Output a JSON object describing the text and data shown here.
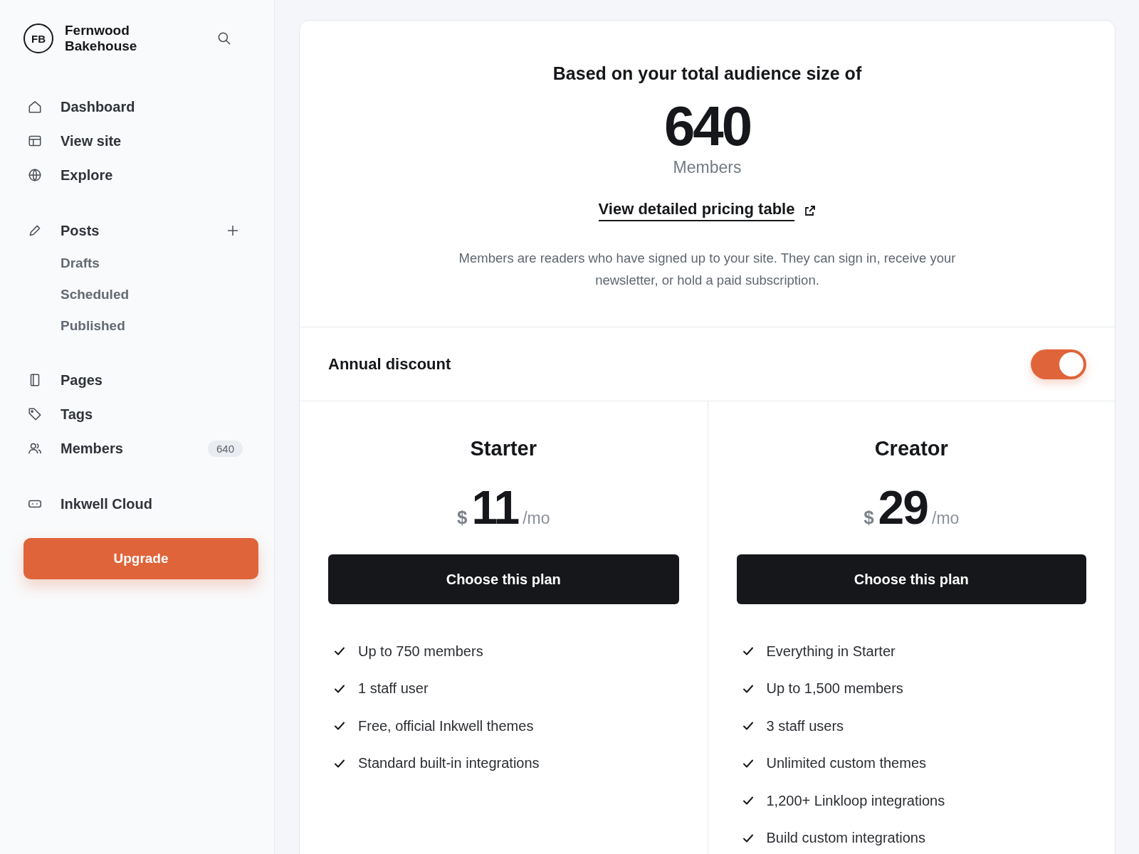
{
  "sidebar": {
    "brand": {
      "initials": "FB",
      "name": "Fernwood Bakehouse"
    },
    "sections": [
      {
        "items": [
          {
            "label": "Dashboard"
          },
          {
            "label": "View site"
          },
          {
            "label": "Explore"
          }
        ]
      },
      {
        "items": [
          {
            "label": "Posts",
            "addable": true,
            "children": [
              {
                "label": "Drafts"
              },
              {
                "label": "Scheduled"
              },
              {
                "label": "Published"
              }
            ]
          }
        ]
      },
      {
        "items": [
          {
            "label": "Pages"
          },
          {
            "label": "Tags"
          },
          {
            "label": "Members",
            "count": "640"
          }
        ]
      },
      {
        "items": [
          {
            "label": "Inkwell Cloud"
          }
        ]
      }
    ],
    "upgrade_button": "Upgrade"
  },
  "pricing": {
    "heading": "Based on your total audience size of",
    "audience": "640",
    "audience_unit": "Members",
    "link": "View detailed pricing table",
    "description": "Members are readers who have signed up to your site. They can sign in, receive your newsletter, or hold a paid subscription.",
    "annual_discount": {
      "label": "Annual discount",
      "on": true
    },
    "plans": [
      {
        "name": "Starter",
        "currency": "$",
        "price": "11",
        "period": "/mo",
        "button": "Choose this plan",
        "features": [
          "Up to 750 members",
          "1 staff user",
          "Free, official Inkwell themes",
          "Standard built-in integrations"
        ]
      },
      {
        "name": "Creator",
        "currency": "$",
        "price": "29",
        "period": "/mo",
        "button": "Choose this plan",
        "features": [
          "Everything in Starter",
          "Up to 1,500 members",
          "3 staff users",
          "Unlimited custom themes",
          "1,200+ Linkloop integrations",
          "Build custom integrations"
        ]
      }
    ]
  }
}
